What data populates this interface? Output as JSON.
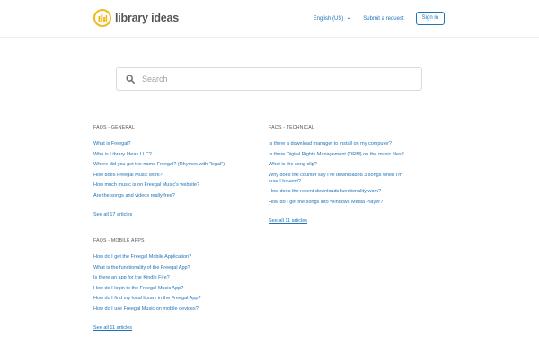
{
  "header": {
    "brand": "library ideas",
    "language": "English (US)",
    "submit_request": "Submit a request",
    "sign_in": "Sign in"
  },
  "search": {
    "placeholder": "Search"
  },
  "sections": [
    {
      "title": "FAQS - GENERAL",
      "articles": [
        "What is Freegal?",
        "Who is Library Ideas LLC?",
        "Where did you get the name Freegal? (Rhymes with \"legal\")",
        "How does Freegal Music work?",
        "How much music is on Freegal Music's website?",
        "Are the songs and videos really free?"
      ],
      "see_all": "See all 17 articles"
    },
    {
      "title": "FAQS - TECHNICAL",
      "articles": [
        "Is there a download manager to install on my computer?",
        "Is there Digital Rights Management (DRM) on the music files?",
        "What is the song clip?",
        "Why does the counter say I've downloaded 3 songs when I'm sure I haven't?",
        "How does the recent downloads functionality work?",
        "How do I get the songs into Windows Media Player?"
      ],
      "see_all": "See all 11 articles"
    },
    {
      "title": "FAQS - MOBILE APPS",
      "articles": [
        "How do I get the Freegal Mobile Application?",
        "What is the functionality of the Freegal App?",
        "Is there an app for the Kindle Fire?",
        "How do I login to the Freegal Music App?",
        "How do I find my local library in the Freegal App?",
        "How do I use Freegal Music on mobile devices?"
      ],
      "see_all": "See all 11 articles"
    }
  ],
  "colors": {
    "link": "#1f73b7",
    "logo_yellow": "#f5b81c",
    "text_muted": "#555555"
  },
  "icons": {
    "logo": "library-ideas-logo-icon",
    "language_chevron": "chevron-down-icon",
    "search": "search-icon"
  }
}
